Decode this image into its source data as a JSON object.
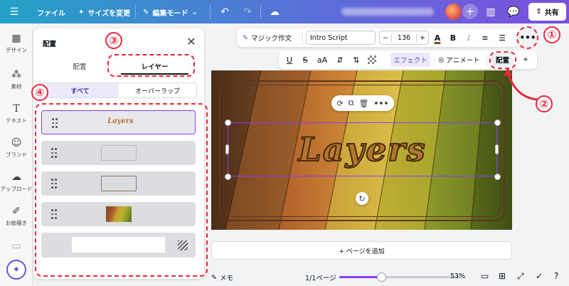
{
  "topbar": {
    "file": "ファイル",
    "resize": "サイズを変更",
    "edit_mode": "編集モード",
    "share": "共有"
  },
  "rail": {
    "items": [
      "デザイン",
      "素材",
      "テキスト",
      "ブランド",
      "アップロード",
      "お絵描き"
    ]
  },
  "panel": {
    "title": "配置",
    "tabs": [
      "配置",
      "レイヤー"
    ],
    "filters": [
      "すべて",
      "オーバーラップ"
    ],
    "layers": [
      "Layers"
    ]
  },
  "toolbar": {
    "magic_write": "マジック作文",
    "font": "Intro Script",
    "font_size": "136",
    "effect": "エフェクト",
    "animate": "アニメート",
    "position": "配置"
  },
  "canvas": {
    "text": "Layers",
    "add_page": "+ ページを追加"
  },
  "bottom": {
    "notes": "メモ",
    "page": "1/1ページ",
    "zoom": "53%",
    "zoom_value": 0.53
  },
  "annotations": [
    "①",
    "②",
    "③",
    "④"
  ],
  "colors": {
    "accent": "#8b3dff",
    "annotation": "#e6293c"
  }
}
